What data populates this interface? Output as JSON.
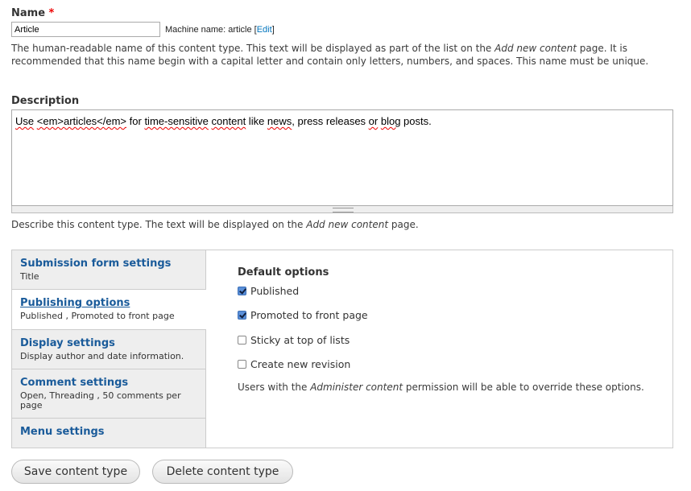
{
  "name_field": {
    "label": "Name",
    "required_mark": "*",
    "value": "Article",
    "machine_name_prefix": "Machine name: article [",
    "machine_name_edit": "Edit",
    "machine_name_suffix": "]",
    "help_part1": "The human-readable name of this content type. This text will be displayed as part of the list on the ",
    "help_em": "Add new content",
    "help_part2": " page. It is",
    "help_line2": "recommended that this name begin with a capital letter and contain only letters, numbers, and spaces. This name must be unique."
  },
  "description_field": {
    "label": "Description",
    "words": [
      "Use",
      " ",
      "<em>articles</em>",
      " for ",
      "time-sensitive",
      " ",
      "content",
      " like ",
      "news",
      ", press releases ",
      "or",
      " ",
      "blog",
      " posts."
    ],
    "help_part1": "Describe this content type. The text will be displayed on the ",
    "help_em": "Add new content",
    "help_part2": " page."
  },
  "vertical_tabs": [
    {
      "title": "Submission form settings",
      "summary": "Title"
    },
    {
      "title": "Publishing options",
      "summary": "Published , Promoted to front page"
    },
    {
      "title": "Display settings",
      "summary": "Display author and date information."
    },
    {
      "title": "Comment settings",
      "summary": "Open, Threading , 50 comments per page"
    },
    {
      "title": "Menu settings",
      "summary": ""
    }
  ],
  "active_tab": 1,
  "default_options": {
    "title": "Default options",
    "checkboxes": [
      {
        "label": "Published",
        "checked": true
      },
      {
        "label": "Promoted to front page",
        "checked": true
      },
      {
        "label": "Sticky at top of lists",
        "checked": false
      },
      {
        "label": "Create new revision",
        "checked": false
      }
    ],
    "help_part1": "Users with the ",
    "help_em": "Administer content",
    "help_part2": " permission will be able to override these options."
  },
  "buttons": {
    "save": "Save content type",
    "delete": "Delete content type"
  }
}
